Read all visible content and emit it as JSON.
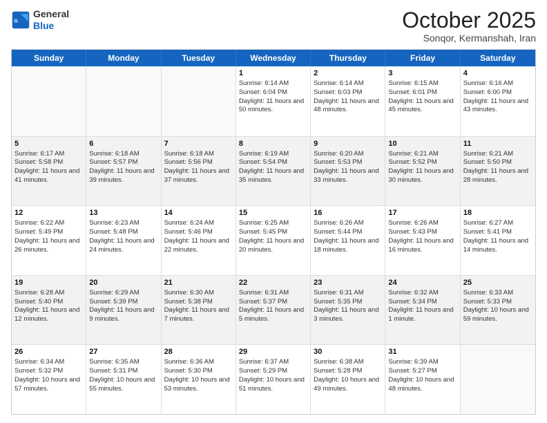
{
  "header": {
    "logo_line1": "General",
    "logo_line2": "Blue",
    "month": "October 2025",
    "location": "Sonqor, Kermanshah, Iran"
  },
  "weekdays": [
    "Sunday",
    "Monday",
    "Tuesday",
    "Wednesday",
    "Thursday",
    "Friday",
    "Saturday"
  ],
  "weeks": [
    [
      {
        "day": "",
        "sunrise": "",
        "sunset": "",
        "daylight": ""
      },
      {
        "day": "",
        "sunrise": "",
        "sunset": "",
        "daylight": ""
      },
      {
        "day": "",
        "sunrise": "",
        "sunset": "",
        "daylight": ""
      },
      {
        "day": "1",
        "sunrise": "Sunrise: 6:14 AM",
        "sunset": "Sunset: 6:04 PM",
        "daylight": "Daylight: 11 hours and 50 minutes."
      },
      {
        "day": "2",
        "sunrise": "Sunrise: 6:14 AM",
        "sunset": "Sunset: 6:03 PM",
        "daylight": "Daylight: 11 hours and 48 minutes."
      },
      {
        "day": "3",
        "sunrise": "Sunrise: 6:15 AM",
        "sunset": "Sunset: 6:01 PM",
        "daylight": "Daylight: 11 hours and 45 minutes."
      },
      {
        "day": "4",
        "sunrise": "Sunrise: 6:16 AM",
        "sunset": "Sunset: 6:00 PM",
        "daylight": "Daylight: 11 hours and 43 minutes."
      }
    ],
    [
      {
        "day": "5",
        "sunrise": "Sunrise: 6:17 AM",
        "sunset": "Sunset: 5:58 PM",
        "daylight": "Daylight: 11 hours and 41 minutes."
      },
      {
        "day": "6",
        "sunrise": "Sunrise: 6:18 AM",
        "sunset": "Sunset: 5:57 PM",
        "daylight": "Daylight: 11 hours and 39 minutes."
      },
      {
        "day": "7",
        "sunrise": "Sunrise: 6:18 AM",
        "sunset": "Sunset: 5:56 PM",
        "daylight": "Daylight: 11 hours and 37 minutes."
      },
      {
        "day": "8",
        "sunrise": "Sunrise: 6:19 AM",
        "sunset": "Sunset: 5:54 PM",
        "daylight": "Daylight: 11 hours and 35 minutes."
      },
      {
        "day": "9",
        "sunrise": "Sunrise: 6:20 AM",
        "sunset": "Sunset: 5:53 PM",
        "daylight": "Daylight: 11 hours and 33 minutes."
      },
      {
        "day": "10",
        "sunrise": "Sunrise: 6:21 AM",
        "sunset": "Sunset: 5:52 PM",
        "daylight": "Daylight: 11 hours and 30 minutes."
      },
      {
        "day": "11",
        "sunrise": "Sunrise: 6:21 AM",
        "sunset": "Sunset: 5:50 PM",
        "daylight": "Daylight: 11 hours and 28 minutes."
      }
    ],
    [
      {
        "day": "12",
        "sunrise": "Sunrise: 6:22 AM",
        "sunset": "Sunset: 5:49 PM",
        "daylight": "Daylight: 11 hours and 26 minutes."
      },
      {
        "day": "13",
        "sunrise": "Sunrise: 6:23 AM",
        "sunset": "Sunset: 5:48 PM",
        "daylight": "Daylight: 11 hours and 24 minutes."
      },
      {
        "day": "14",
        "sunrise": "Sunrise: 6:24 AM",
        "sunset": "Sunset: 5:46 PM",
        "daylight": "Daylight: 11 hours and 22 minutes."
      },
      {
        "day": "15",
        "sunrise": "Sunrise: 6:25 AM",
        "sunset": "Sunset: 5:45 PM",
        "daylight": "Daylight: 11 hours and 20 minutes."
      },
      {
        "day": "16",
        "sunrise": "Sunrise: 6:26 AM",
        "sunset": "Sunset: 5:44 PM",
        "daylight": "Daylight: 11 hours and 18 minutes."
      },
      {
        "day": "17",
        "sunrise": "Sunrise: 6:26 AM",
        "sunset": "Sunset: 5:43 PM",
        "daylight": "Daylight: 11 hours and 16 minutes."
      },
      {
        "day": "18",
        "sunrise": "Sunrise: 6:27 AM",
        "sunset": "Sunset: 5:41 PM",
        "daylight": "Daylight: 11 hours and 14 minutes."
      }
    ],
    [
      {
        "day": "19",
        "sunrise": "Sunrise: 6:28 AM",
        "sunset": "Sunset: 5:40 PM",
        "daylight": "Daylight: 11 hours and 12 minutes."
      },
      {
        "day": "20",
        "sunrise": "Sunrise: 6:29 AM",
        "sunset": "Sunset: 5:39 PM",
        "daylight": "Daylight: 11 hours and 9 minutes."
      },
      {
        "day": "21",
        "sunrise": "Sunrise: 6:30 AM",
        "sunset": "Sunset: 5:38 PM",
        "daylight": "Daylight: 11 hours and 7 minutes."
      },
      {
        "day": "22",
        "sunrise": "Sunrise: 6:31 AM",
        "sunset": "Sunset: 5:37 PM",
        "daylight": "Daylight: 11 hours and 5 minutes."
      },
      {
        "day": "23",
        "sunrise": "Sunrise: 6:31 AM",
        "sunset": "Sunset: 5:35 PM",
        "daylight": "Daylight: 11 hours and 3 minutes."
      },
      {
        "day": "24",
        "sunrise": "Sunrise: 6:32 AM",
        "sunset": "Sunset: 5:34 PM",
        "daylight": "Daylight: 11 hours and 1 minute."
      },
      {
        "day": "25",
        "sunrise": "Sunrise: 6:33 AM",
        "sunset": "Sunset: 5:33 PM",
        "daylight": "Daylight: 10 hours and 59 minutes."
      }
    ],
    [
      {
        "day": "26",
        "sunrise": "Sunrise: 6:34 AM",
        "sunset": "Sunset: 5:32 PM",
        "daylight": "Daylight: 10 hours and 57 minutes."
      },
      {
        "day": "27",
        "sunrise": "Sunrise: 6:35 AM",
        "sunset": "Sunset: 5:31 PM",
        "daylight": "Daylight: 10 hours and 55 minutes."
      },
      {
        "day": "28",
        "sunrise": "Sunrise: 6:36 AM",
        "sunset": "Sunset: 5:30 PM",
        "daylight": "Daylight: 10 hours and 53 minutes."
      },
      {
        "day": "29",
        "sunrise": "Sunrise: 6:37 AM",
        "sunset": "Sunset: 5:29 PM",
        "daylight": "Daylight: 10 hours and 51 minutes."
      },
      {
        "day": "30",
        "sunrise": "Sunrise: 6:38 AM",
        "sunset": "Sunset: 5:28 PM",
        "daylight": "Daylight: 10 hours and 49 minutes."
      },
      {
        "day": "31",
        "sunrise": "Sunrise: 6:39 AM",
        "sunset": "Sunset: 5:27 PM",
        "daylight": "Daylight: 10 hours and 48 minutes."
      },
      {
        "day": "",
        "sunrise": "",
        "sunset": "",
        "daylight": ""
      }
    ]
  ]
}
